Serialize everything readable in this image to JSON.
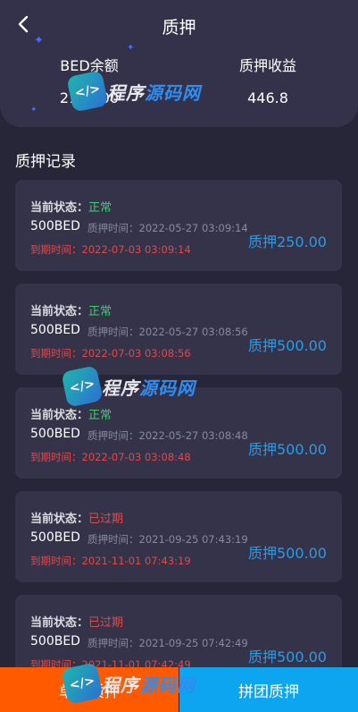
{
  "header": {
    "title": "质押",
    "balance_label": "BED余额",
    "balance_value": "2139.00",
    "earnings_label": "质押收益",
    "earnings_value": "446.8"
  },
  "section_title": "质押记录",
  "labels": {
    "status": "当前状态：",
    "pledge_time": "质押时间：",
    "expire_time": "到期时间："
  },
  "records": [
    {
      "status": "正常",
      "status_color": "#3fcf6f",
      "amount": "500BED",
      "pledge_time": "2022-05-27 03:09:14",
      "expire_time": "2022-07-03 03:09:14",
      "value": "质押250.00"
    },
    {
      "status": "正常",
      "status_color": "#3fcf6f",
      "amount": "500BED",
      "pledge_time": "2022-05-27 03:08:56",
      "expire_time": "2022-07-03 03:08:56",
      "value": "质押500.00"
    },
    {
      "status": "正常",
      "status_color": "#3fcf6f",
      "amount": "500BED",
      "pledge_time": "2022-05-27 03:08:48",
      "expire_time": "2022-07-03 03:08:48",
      "value": "质押500.00"
    },
    {
      "status": "已过期",
      "status_color": "#e04a4a",
      "amount": "500BED",
      "pledge_time": "2021-09-25 07:43:19",
      "expire_time": "2021-11-01 07:43:19",
      "value": "质押500.00"
    },
    {
      "status": "已过期",
      "status_color": "#e04a4a",
      "amount": "500BED",
      "pledge_time": "2021-09-25 07:42:49",
      "expire_time": "2021-11-01 07:42:49",
      "value": "质押500.00"
    }
  ],
  "buttons": {
    "single_pledge": "单人质押",
    "group_pledge": "拼团质押"
  },
  "watermark": {
    "logo_glyph": "</>",
    "text_a": "程序",
    "text_b": "源码网"
  },
  "colors": {
    "background": "#272638",
    "card": "#34334a",
    "accent_blue": "#2a9be6",
    "single_button": "#ff5a00",
    "group_button": "#0ea5f0"
  }
}
